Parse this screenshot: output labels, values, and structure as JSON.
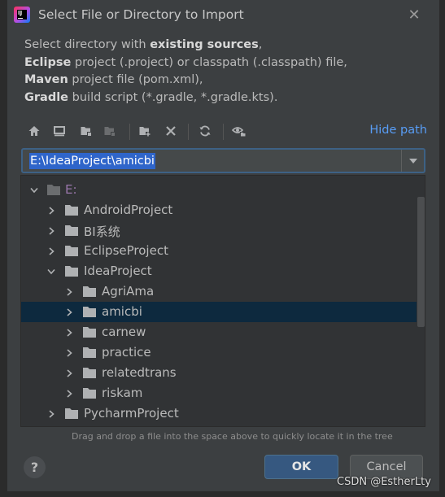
{
  "window": {
    "title": "Select File or Directory to Import",
    "app_icon_text": "IJ"
  },
  "description": {
    "line1_prefix": "Select directory with ",
    "line1_bold": "existing sources",
    "line1_suffix": ",",
    "line2_bold": "Eclipse",
    "line2_rest": " project (.project) or classpath (.classpath) file,",
    "line3_bold": "Maven",
    "line3_rest": " project file (pom.xml),",
    "line4_bold": "Gradle",
    "line4_rest": " build script (*.gradle, *.gradle.kts)."
  },
  "toolbar": {
    "icons": [
      "home-icon",
      "desktop-icon",
      "project-folder-icon",
      "module-folder-icon",
      "new-folder-icon",
      "delete-icon",
      "refresh-icon",
      "show-hidden-icon"
    ],
    "hide_path_label": "Hide path"
  },
  "path_field": {
    "value": "E:\\IdeaProject\\amicbi"
  },
  "tree": {
    "drive_label": "E:",
    "items": [
      {
        "label": "AndroidProject",
        "expanded": false
      },
      {
        "label": "BI系统",
        "expanded": false
      },
      {
        "label": "EclipseProject",
        "expanded": false
      },
      {
        "label": "IdeaProject",
        "expanded": true
      },
      {
        "label": "AgriAma",
        "expanded": false
      },
      {
        "label": "amicbi",
        "expanded": false,
        "selected": true
      },
      {
        "label": "carnew",
        "expanded": false
      },
      {
        "label": "practice",
        "expanded": false
      },
      {
        "label": "relatedtrans",
        "expanded": false
      },
      {
        "label": "riskam",
        "expanded": false
      },
      {
        "label": "PycharmProject",
        "expanded": false
      }
    ]
  },
  "hint": "Drag and drop a file into the space above to quickly locate it in the tree",
  "buttons": {
    "help": "?",
    "ok": "OK",
    "cancel": "Cancel"
  },
  "watermark": "CSDN @EstherLty",
  "colors": {
    "background": "#3c3f41",
    "accent_link": "#589df6",
    "selection": "#2f65ca",
    "tree_selected_row": "#0d293e",
    "ok_button": "#365880",
    "folder": "#afb1b3",
    "drive_label": "#9876aa"
  }
}
